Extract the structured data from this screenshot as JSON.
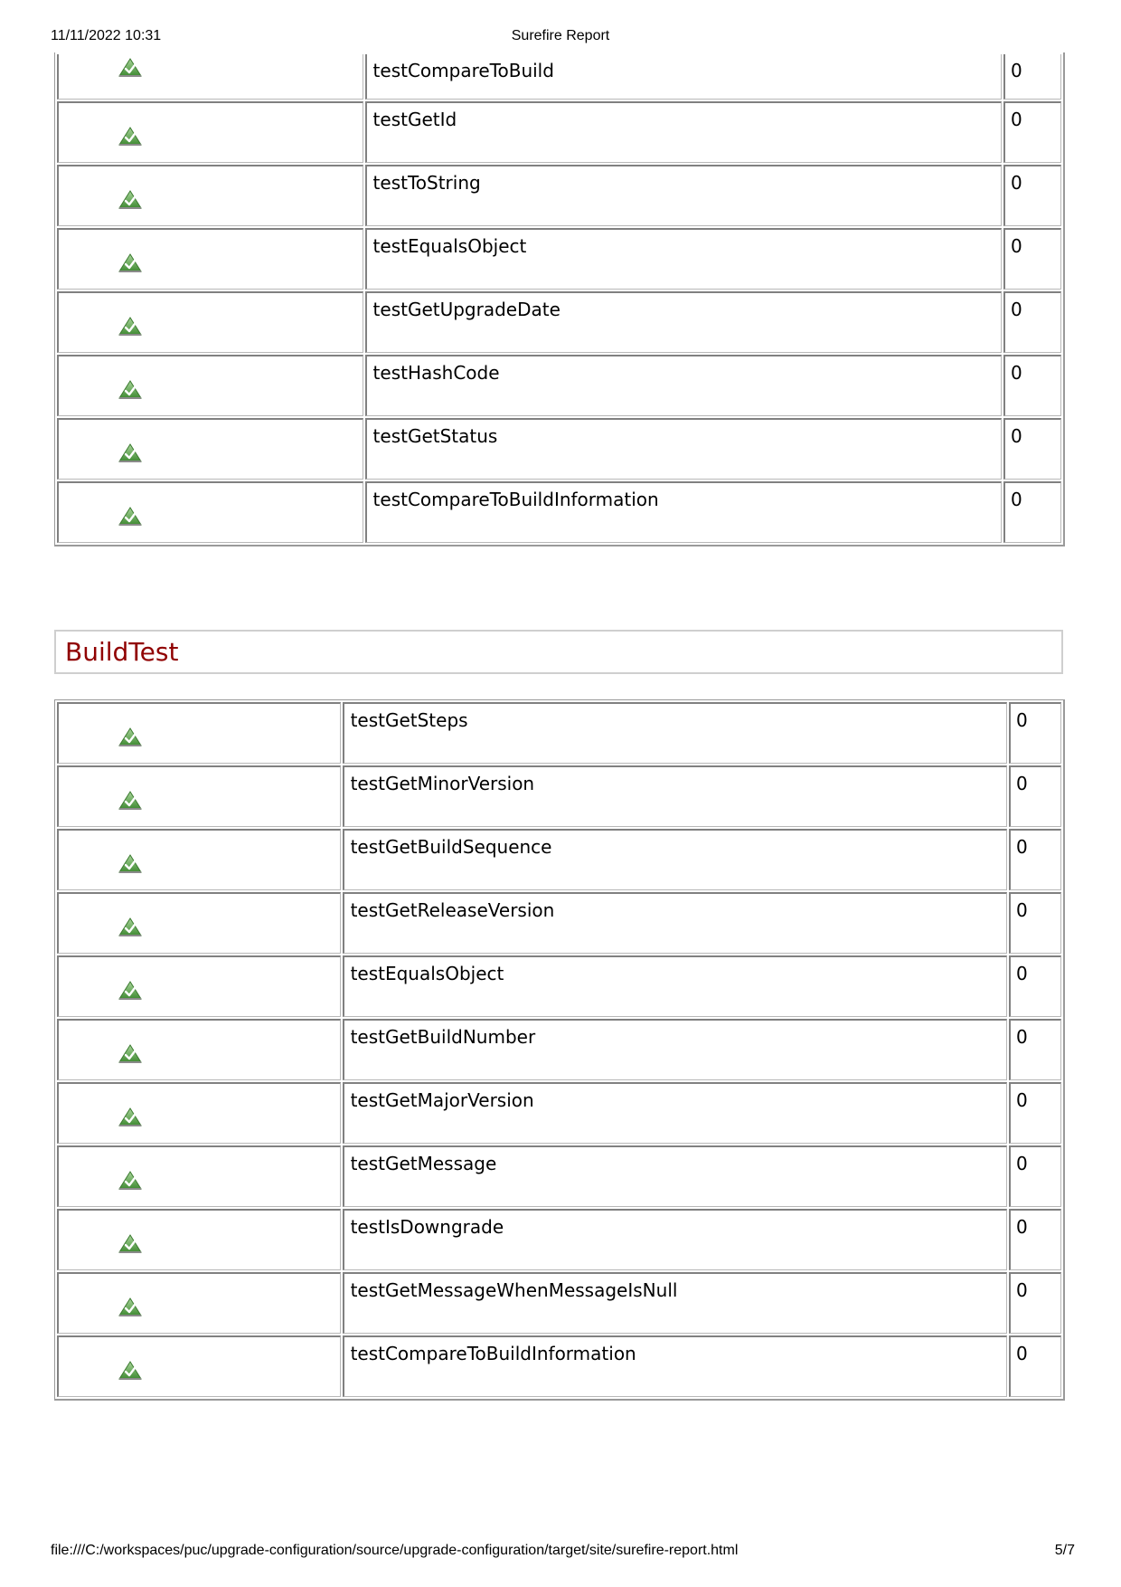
{
  "print_header": {
    "datetime": "11/11/2022 10:31",
    "title": "Surefire Report"
  },
  "print_footer": {
    "path": "file:///C:/workspaces/puc/upgrade-configuration/source/upgrade-configuration/target/site/surefire-report.html",
    "page": "5/7"
  },
  "status_icon": "success-icon",
  "colors": {
    "heading": "#900000",
    "icon_green": "#4f9a3c"
  },
  "previous_section": {
    "tests": [
      {
        "name": "testCompareToBuild",
        "time": "0"
      },
      {
        "name": "testGetId",
        "time": "0"
      },
      {
        "name": "testToString",
        "time": "0"
      },
      {
        "name": "testEqualsObject",
        "time": "0"
      },
      {
        "name": "testGetUpgradeDate",
        "time": "0"
      },
      {
        "name": "testHashCode",
        "time": "0"
      },
      {
        "name": "testGetStatus",
        "time": "0"
      },
      {
        "name": "testCompareToBuildInformation",
        "time": "0"
      }
    ]
  },
  "build_test": {
    "heading": "BuildTest",
    "tests": [
      {
        "name": "testGetSteps",
        "time": "0"
      },
      {
        "name": "testGetMinorVersion",
        "time": "0"
      },
      {
        "name": "testGetBuildSequence",
        "time": "0"
      },
      {
        "name": "testGetReleaseVersion",
        "time": "0"
      },
      {
        "name": "testEqualsObject",
        "time": "0"
      },
      {
        "name": "testGetBuildNumber",
        "time": "0"
      },
      {
        "name": "testGetMajorVersion",
        "time": "0"
      },
      {
        "name": "testGetMessage",
        "time": "0"
      },
      {
        "name": "testIsDowngrade",
        "time": "0"
      },
      {
        "name": "testGetMessageWhenMessageIsNull",
        "time": "0"
      },
      {
        "name": "testCompareToBuildInformation",
        "time": "0"
      }
    ]
  }
}
